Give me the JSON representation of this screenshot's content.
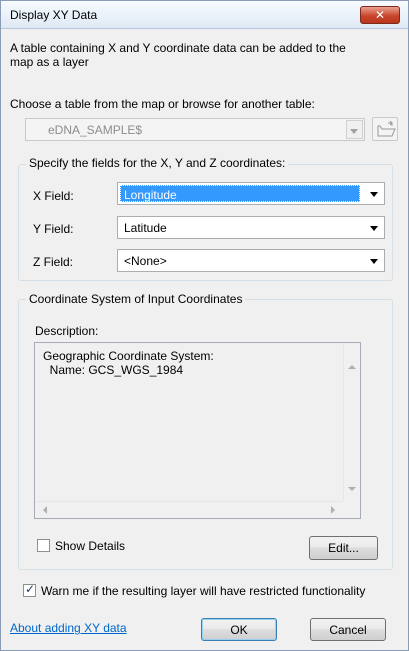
{
  "window": {
    "title": "Display XY Data",
    "close_glyph": "✕"
  },
  "intro": {
    "line1": "A table containing X and Y coordinate data can be added to the",
    "line2": "map as a layer"
  },
  "table_picker": {
    "label": "Choose a table from the map or browse for another table:",
    "selected": "eDNA_SAMPLE$"
  },
  "fields_group": {
    "title": "Specify the fields for the X, Y and Z coordinates:",
    "x": {
      "label": "X Field:",
      "value": "Longitude"
    },
    "y": {
      "label": "Y Field:",
      "value": "Latitude"
    },
    "z": {
      "label": "Z Field:",
      "value": "<None>"
    }
  },
  "coord_group": {
    "title": "Coordinate System of Input Coordinates",
    "description_label": "Description:",
    "description_line1": "Geographic Coordinate System:",
    "description_line2": "  Name: GCS_WGS_1984",
    "show_details_label": "Show Details",
    "show_details_checked": false,
    "edit_button": "Edit..."
  },
  "warn": {
    "label": "Warn me if the resulting layer will have restricted functionality",
    "checked": true
  },
  "footer": {
    "help_link": "About adding XY data",
    "ok": "OK",
    "cancel": "Cancel"
  },
  "colors": {
    "selection": "#3399ff",
    "link": "#0066cc",
    "close_button": "#c9462c"
  }
}
